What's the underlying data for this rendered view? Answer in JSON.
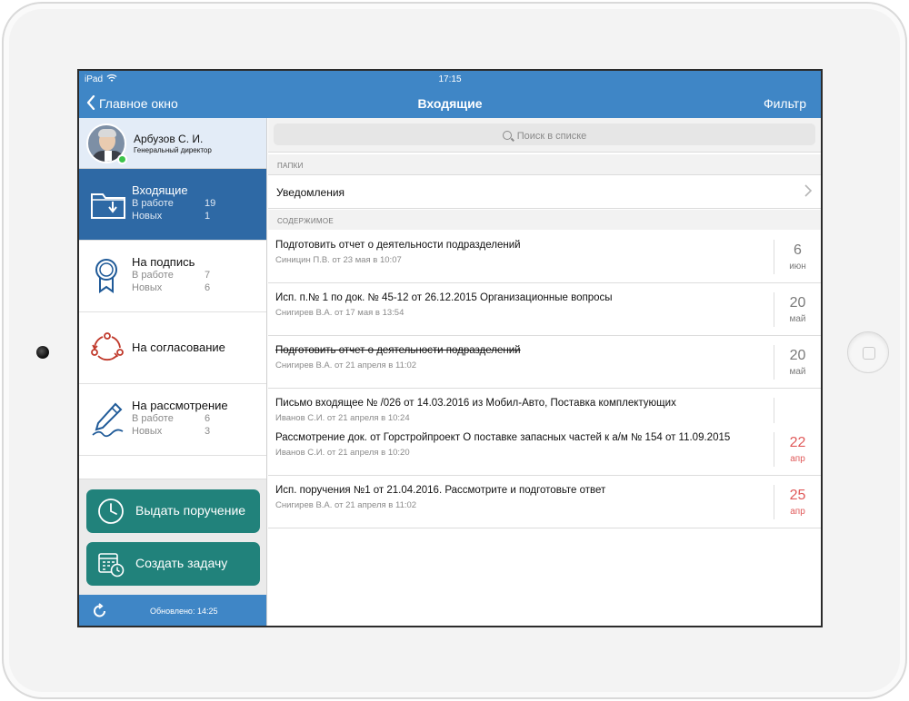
{
  "statusbar": {
    "device": "iPad",
    "time": "17:15"
  },
  "navbar": {
    "back_label": "Главное окно",
    "title": "Входящие",
    "filter_label": "Фильтр"
  },
  "profile": {
    "name": "Арбузов С. И.",
    "role": "Генеральный директор"
  },
  "sidebar": {
    "items": [
      {
        "label": "Входящие",
        "stats": [
          {
            "label": "В работе",
            "value": "19"
          },
          {
            "label": "Новых",
            "value": "1"
          }
        ]
      },
      {
        "label": "На подпись",
        "stats": [
          {
            "label": "В работе",
            "value": "7"
          },
          {
            "label": "Новых",
            "value": "6"
          }
        ]
      },
      {
        "label": "На согласование"
      },
      {
        "label": "На рассмотрение",
        "stats": [
          {
            "label": "В работе",
            "value": "6"
          },
          {
            "label": "Новых",
            "value": "3"
          }
        ]
      }
    ],
    "actions": [
      {
        "label": "Выдать поручение"
      },
      {
        "label": "Создать задачу"
      }
    ],
    "updated": "Обновлено: 14:25"
  },
  "search": {
    "placeholder": "Поиск в списке"
  },
  "sections": {
    "folders": "ПАПКИ",
    "content": "СОДЕРЖИМОЕ"
  },
  "folders": [
    {
      "label": "Уведомления"
    }
  ],
  "documents": [
    {
      "title": "Подготовить отчет о деятельности подразделений",
      "meta": "Синицин П.В. от 23 мая в 10:07",
      "day": "6",
      "month": "июн"
    },
    {
      "title": "Исп. п.№ 1 по док. № 45-12 от 26.12.2015 Организационные вопросы",
      "meta": "Снигирев В.А. от 17 мая в 13:54",
      "day": "20",
      "month": "май"
    },
    {
      "title": "Подготовить отчет о деятельности подразделений",
      "meta": "Снигирев В.А. от 21 апреля в 11:02",
      "day": "20",
      "month": "май"
    },
    {
      "title": "Письмо входящее № /026 от 14.03.2016 из Мобил-Авто,  Поставка комплектующих",
      "meta": "Иванов  С.И. от 21 апреля в 10:24",
      "day": "",
      "month": ""
    },
    {
      "title": "Рассмотрение док. от Горстройпроект О поставке запасных частей к а/м № 154 от 11.09.2015",
      "meta": "Иванов  С.И. от 21 апреля в 10:20",
      "day": "22",
      "month": "апр"
    },
    {
      "title": "Исп. поручения №1 от 21.04.2016. Рассмотрите и подготовьте ответ",
      "meta": "Снигирев В.А. от 21 апреля в 11:02",
      "day": "25",
      "month": "апр"
    }
  ],
  "colors": {
    "accent": "#3f86c6",
    "active_item": "#2e69a5",
    "action_button": "#21827b",
    "overdue": "#e05a5a",
    "online": "#3cc44b"
  },
  "icons": [
    "back-chevron-icon",
    "wifi-icon",
    "folder-inbox-icon",
    "award-ribbon-icon",
    "cycle-arrows-icon",
    "pen-sign-icon",
    "clock-icon",
    "calendar-clock-icon",
    "refresh-icon",
    "search-icon",
    "chevron-right-icon"
  ]
}
